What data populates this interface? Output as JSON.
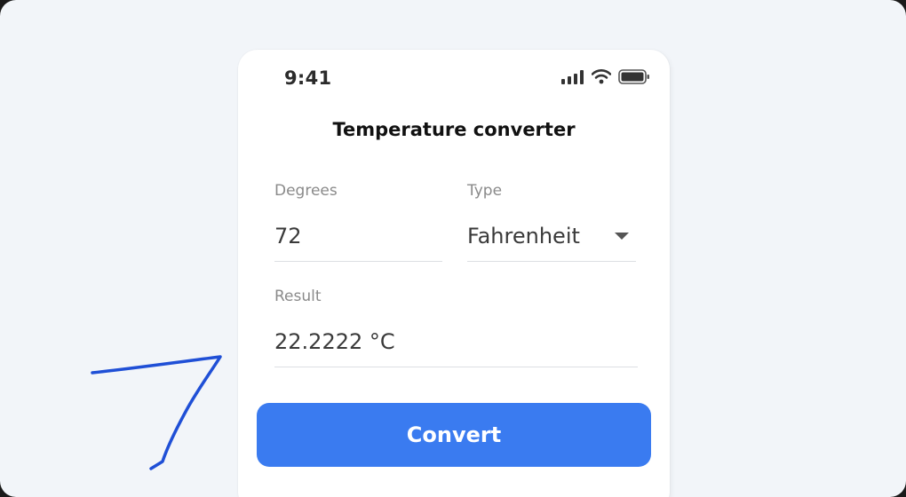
{
  "status_bar": {
    "time": "9:41",
    "icons": [
      "signal-icon",
      "wifi-icon",
      "battery-icon"
    ]
  },
  "app": {
    "title": "Temperature converter"
  },
  "form": {
    "degrees_label": "Degrees",
    "degrees_value": "72",
    "type_label": "Type",
    "type_selected": "Fahrenheit",
    "result_label": "Result",
    "result_value": "22.2222 °C",
    "convert_label": "Convert"
  },
  "colors": {
    "accent": "#3a7bf0",
    "background": "#f2f5f9",
    "card": "#ffffff",
    "ink_annotation": "#1f4fd6"
  },
  "annotation": {
    "handwritten": "7"
  }
}
